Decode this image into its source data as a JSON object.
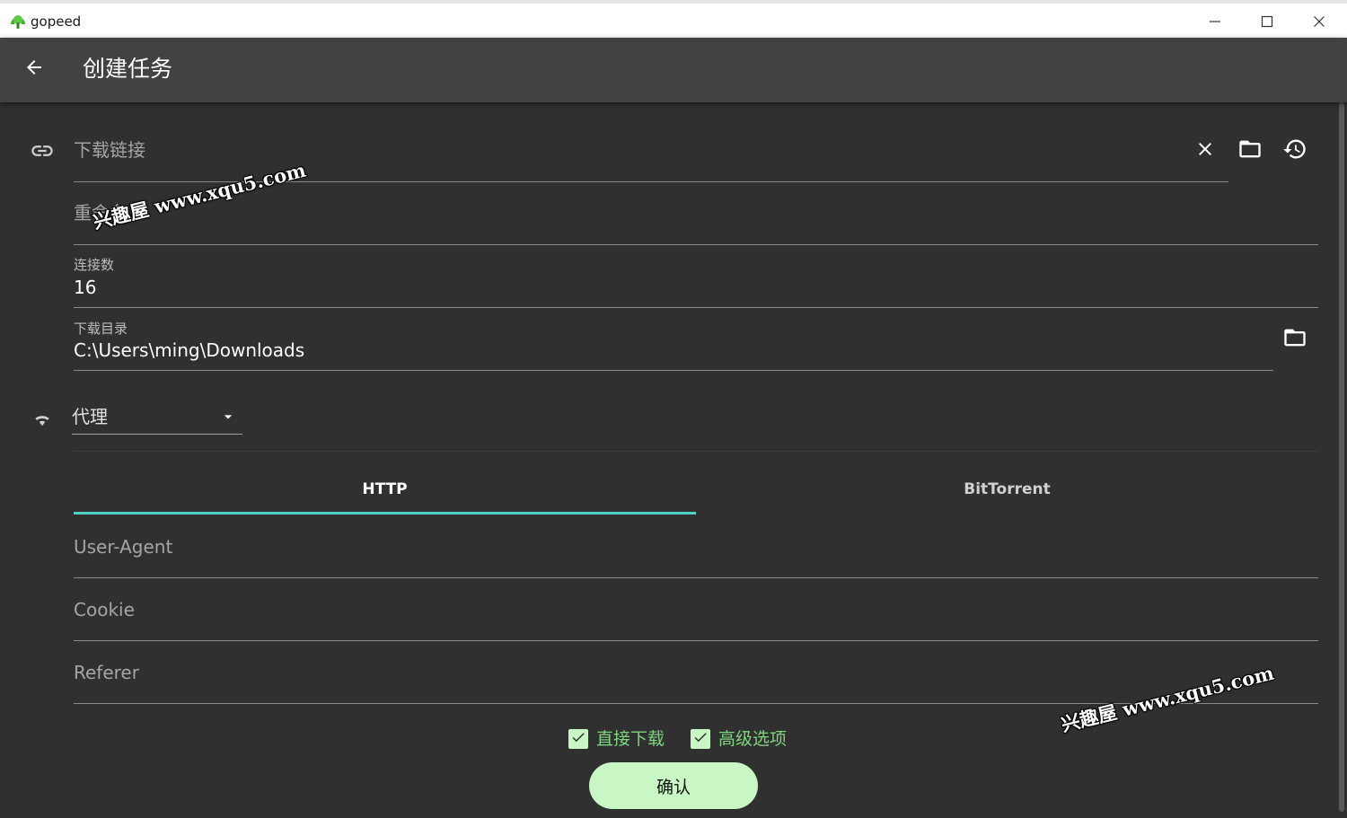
{
  "window": {
    "app_name": "gopeed",
    "minimize_icon": "minimize-icon",
    "maximize_icon": "maximize-icon",
    "close_icon": "close-icon"
  },
  "appbar": {
    "back_icon": "arrow-left-icon",
    "title": "创建任务"
  },
  "form": {
    "url": {
      "placeholder": "下载链接",
      "value": "",
      "icons": [
        "link-icon",
        "clear-icon",
        "folder-icon",
        "history-icon"
      ]
    },
    "rename": {
      "placeholder": "重命名",
      "value": ""
    },
    "connections": {
      "label": "连接数",
      "value": "16"
    },
    "download_dir": {
      "label": "下载目录",
      "value": "C:\\Users\\ming\\Downloads",
      "icon": "folder-icon"
    },
    "proxy": {
      "label": "代理",
      "icon": "wifi-icon"
    }
  },
  "tabs": [
    {
      "label": "HTTP",
      "active": true
    },
    {
      "label": "BitTorrent",
      "active": false
    }
  ],
  "http": {
    "user_agent": {
      "placeholder": "User-Agent",
      "value": ""
    },
    "cookie": {
      "placeholder": "Cookie",
      "value": ""
    },
    "referer": {
      "placeholder": "Referer",
      "value": ""
    }
  },
  "options": {
    "direct_download": {
      "label": "直接下载",
      "checked": true
    },
    "advanced": {
      "label": "高级选项",
      "checked": true
    }
  },
  "confirm_label": "确认",
  "watermarks": [
    "兴趣屋 www.xqu5.com",
    "兴趣屋 www.xqu5.com"
  ],
  "colors": {
    "accent": "#4fd1c5",
    "primary_light": "#c8f7c5",
    "checkbox_label": "#7ed67e",
    "background": "#303030",
    "appbar": "#424242"
  }
}
